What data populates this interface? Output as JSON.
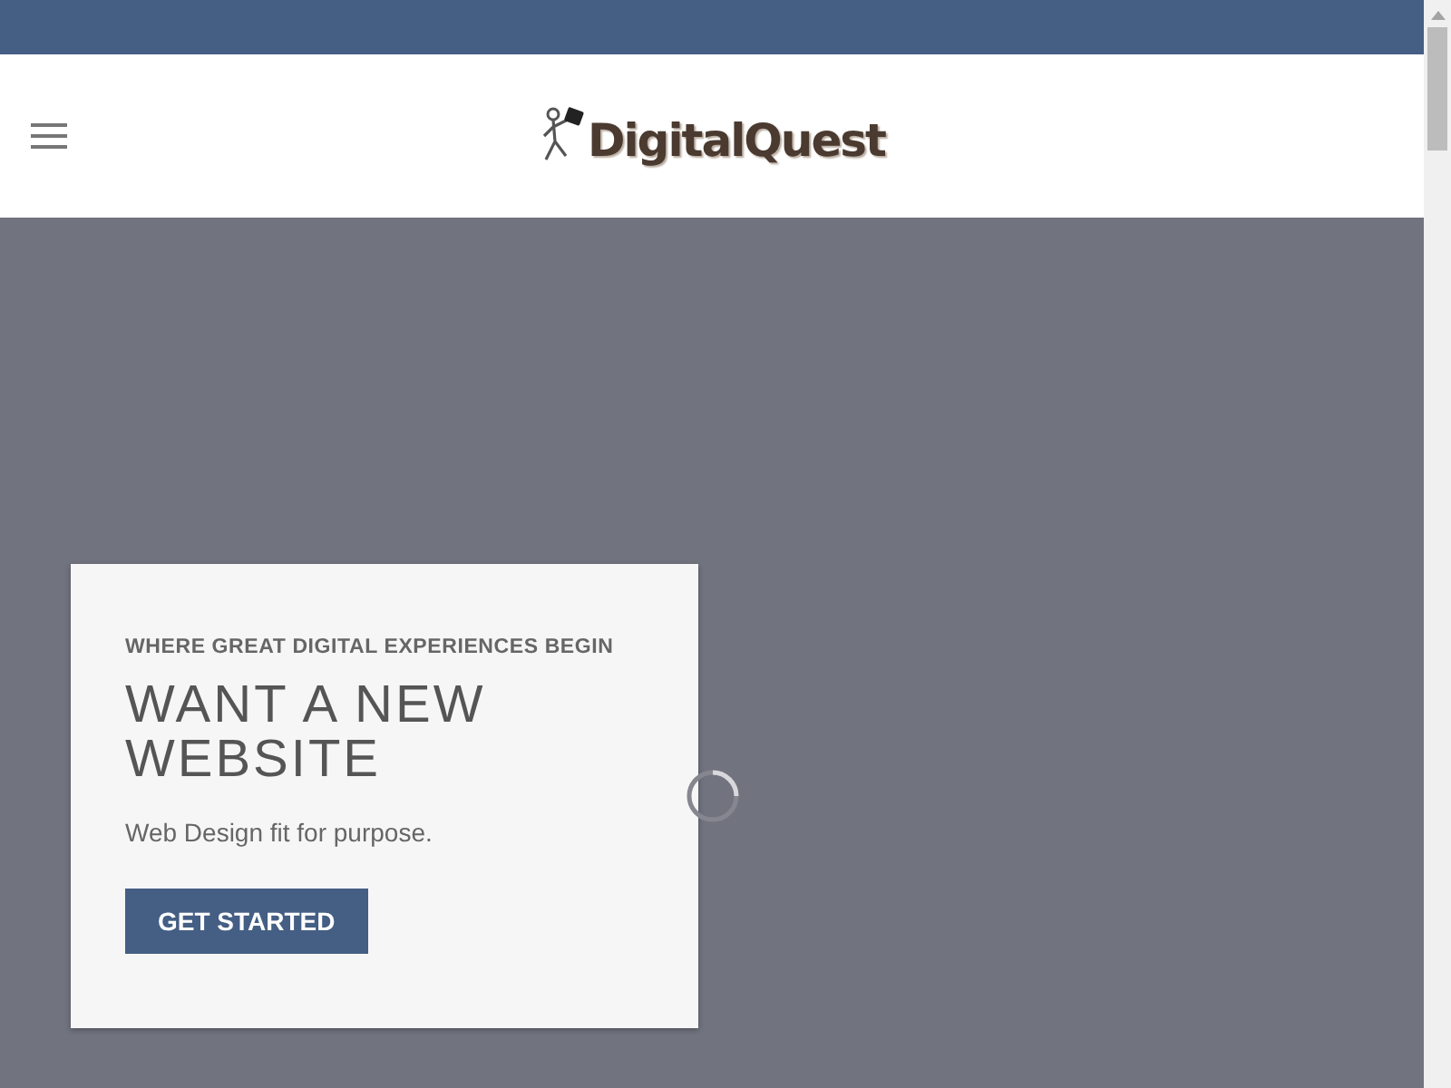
{
  "logo": {
    "text": "DigitalQuest"
  },
  "hero": {
    "eyebrow": "WHERE GREAT DIGITAL EXPERIENCES BEGIN",
    "title": "WANT A NEW WEBSITE",
    "subtitle": "Web Design fit for purpose.",
    "button": "GET STARTED"
  }
}
